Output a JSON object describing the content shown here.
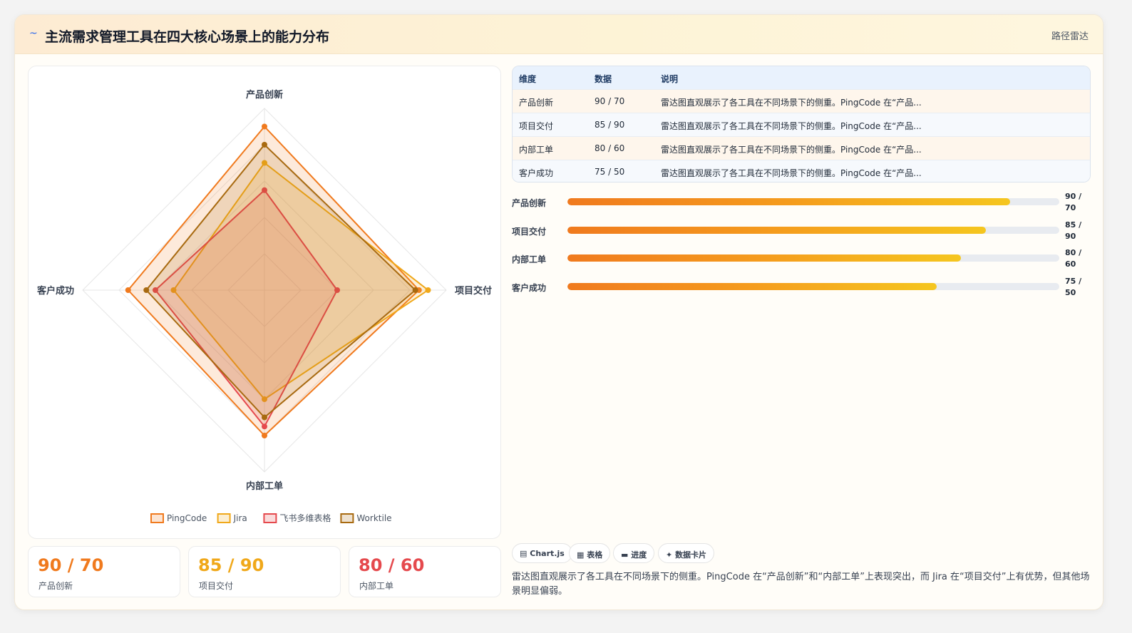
{
  "header": {
    "icon": "wave-icon",
    "title": "主流需求管理工具在四大核心场景上的能力分布",
    "tag": "路径雷达"
  },
  "chart_data": {
    "type": "radar",
    "axes": [
      "产品创新",
      "项目交付",
      "内部工单",
      "客户成功"
    ],
    "range": [
      0,
      100
    ],
    "series": [
      {
        "name": "PingCode",
        "color": "#f07a1e",
        "values": [
          90,
          85,
          80,
          75
        ]
      },
      {
        "name": "Jira",
        "color": "#f0a81a",
        "values": [
          70,
          90,
          60,
          50
        ]
      },
      {
        "name": "飞书多维表格",
        "color": "#e5494d",
        "values": [
          55,
          40,
          75,
          60
        ]
      },
      {
        "name": "Worktile",
        "color": "#a86a10",
        "values": [
          80,
          83,
          70,
          65
        ]
      }
    ],
    "legend_position": "bottom"
  },
  "stats": [
    {
      "value": "90 / 70",
      "label": "产品创新",
      "color": "#f07a1e"
    },
    {
      "value": "85 / 90",
      "label": "项目交付",
      "color": "#f0a81a"
    },
    {
      "value": "80 / 60",
      "label": "内部工单",
      "color": "#e5494d"
    }
  ],
  "table": {
    "headers": [
      "维度",
      "数据",
      "说明"
    ],
    "rows": [
      {
        "dim": "产品创新",
        "data": "90 / 70",
        "desc": "雷达图直观展示了各工具在不同场景下的侧重。PingCode 在“产品..."
      },
      {
        "dim": "项目交付",
        "data": "85 / 90",
        "desc": "雷达图直观展示了各工具在不同场景下的侧重。PingCode 在“产品..."
      },
      {
        "dim": "内部工单",
        "data": "80 / 60",
        "desc": "雷达图直观展示了各工具在不同场景下的侧重。PingCode 在“产品..."
      },
      {
        "dim": "客户成功",
        "data": "75 / 50",
        "desc": "雷达图直观展示了各工具在不同场景下的侧重。PingCode 在“产品..."
      }
    ]
  },
  "progress": [
    {
      "label": "产品创新",
      "value": "90 / 70",
      "percent": 90
    },
    {
      "label": "项目交付",
      "value": "85 / 90",
      "percent": 85
    },
    {
      "label": "内部工单",
      "value": "80 / 60",
      "percent": 80
    },
    {
      "label": "客户成功",
      "value": "75 / 50",
      "percent": 75
    }
  ],
  "chips": [
    {
      "icon": "chart-icon",
      "glyph": "▤",
      "label": "Chart.js"
    },
    {
      "icon": "table-icon",
      "glyph": "▦",
      "label": "表格"
    },
    {
      "icon": "progress-icon",
      "glyph": "▬",
      "label": "进度"
    },
    {
      "icon": "sparkle-icon",
      "glyph": "✦",
      "label": "数据卡片"
    }
  ],
  "description": "雷达图直观展示了各工具在不同场景下的侧重。PingCode 在“产品创新”和“内部工单”上表现突出，而 Jira 在“项目交付”上有优势，但其他场景明显偏弱。"
}
